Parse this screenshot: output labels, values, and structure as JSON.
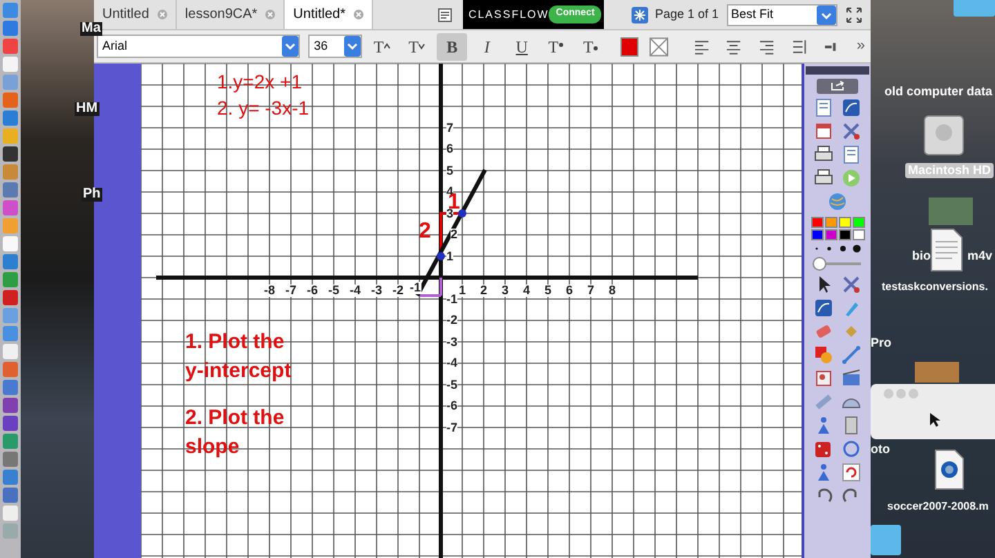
{
  "tabs": [
    {
      "label": "Untitled",
      "selected": false
    },
    {
      "label": "lesson9CA*",
      "selected": false
    },
    {
      "label": "Untitled*",
      "selected": true
    }
  ],
  "classflow": {
    "logo": "CLASSFLOW",
    "button": "Connect"
  },
  "page_indicator": "Page 1 of 1",
  "zoom_select": {
    "value": "Best Fit"
  },
  "font_select": {
    "value": "Arial"
  },
  "size_select": {
    "value": "36"
  },
  "format_buttons": [
    {
      "kind": "grow",
      "label": "T"
    },
    {
      "kind": "shrink",
      "label": "T"
    },
    {
      "kind": "bold",
      "label": "B",
      "pressed": true
    },
    {
      "kind": "italic",
      "label": "I",
      "pressed": false
    },
    {
      "kind": "underline",
      "label": "U",
      "pressed": false
    },
    {
      "kind": "superscript",
      "label": "T"
    },
    {
      "kind": "subscript",
      "label": "T"
    }
  ],
  "more_button": "»",
  "whiteboard": {
    "equations": [
      "1.y=2x +1",
      "2. y= -3x-1"
    ],
    "steps": [
      "1. Plot the",
      "y-intercept",
      "2. Plot the",
      "slope"
    ],
    "x_labels": [
      "-8",
      "-7",
      "-6",
      "-5",
      "-4",
      "-3",
      "-2",
      "-1",
      "1",
      "2",
      "3",
      "4",
      "5",
      "6",
      "7",
      "8"
    ],
    "y_labels": [
      "7",
      "6",
      "5",
      "4",
      "3",
      "2",
      "1",
      "-1",
      "-2",
      "-3",
      "-4",
      "-5",
      "-6",
      "-7"
    ],
    "slope_labels": [
      "1",
      "2"
    ]
  },
  "tool_panel": {
    "palette": [
      {
        "color": "#ff0000"
      },
      {
        "color": "#ff9900"
      },
      {
        "color": "#ffff00"
      },
      {
        "color": "#00ff00"
      },
      {
        "color": "#0000ff"
      },
      {
        "color": "#cc00cc"
      },
      {
        "color": "#000000"
      },
      {
        "color": "#ffffff"
      }
    ],
    "pen_width": {
      "level": 0.12
    }
  },
  "desktop_left_labels": [
    "Ma",
    "HM",
    "Ph"
  ],
  "desktop_right": {
    "folder_label": "old computer data",
    "drive_label": "Macintosh HD",
    "video_label_start": "bio",
    "video_label_end": "m4v",
    "file_label": "testaskconversions.",
    "cut_label_1": "Pro",
    "cut_label_2": "oto",
    "movie_label": "soccer2007-2008.m"
  }
}
